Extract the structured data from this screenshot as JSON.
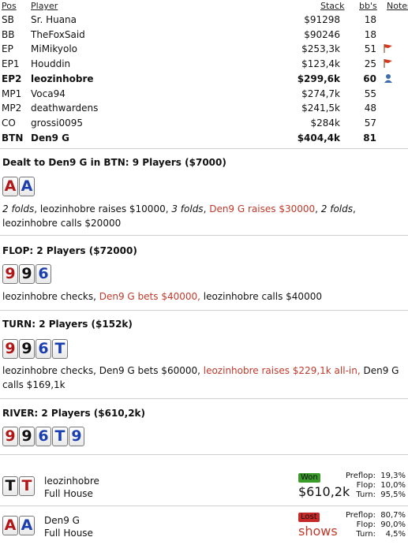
{
  "header": {
    "pos": "Pos",
    "player": "Player",
    "stack": "Stack",
    "bbs": "bb's",
    "notes": "Notes"
  },
  "players": [
    {
      "pos": "SB",
      "name": "Sr. Huana",
      "stack": "$91298",
      "bbs": "18",
      "note": "",
      "bold": false
    },
    {
      "pos": "BB",
      "name": "TheFoxSaid",
      "stack": "$90246",
      "bbs": "18",
      "note": "",
      "bold": false
    },
    {
      "pos": "EP",
      "name": "MiMikyolo",
      "stack": "$253,3k",
      "bbs": "51",
      "note": "flag-icon",
      "bold": false
    },
    {
      "pos": "EP1",
      "name": "Houddin",
      "stack": "$123,4k",
      "bbs": "25",
      "note": "flag-icon",
      "bold": false
    },
    {
      "pos": "EP2",
      "name": "leozinhobre",
      "stack": "$299,6k",
      "bbs": "60",
      "note": "user-icon",
      "bold": true
    },
    {
      "pos": "MP1",
      "name": "Voca94",
      "stack": "$274,7k",
      "bbs": "55",
      "note": "",
      "bold": false
    },
    {
      "pos": "MP2",
      "name": "deathwardens",
      "stack": "$241,5k",
      "bbs": "48",
      "note": "",
      "bold": false
    },
    {
      "pos": "CO",
      "name": "grossi0095",
      "stack": "$284k",
      "bbs": "57",
      "note": "",
      "bold": false
    },
    {
      "pos": "BTN",
      "name": "Den9 G",
      "stack": "$404,4k",
      "bbs": "81",
      "note": "",
      "bold": true
    }
  ],
  "preflop": {
    "title": "Dealt to Den9 G in BTN: 9 Players ($7000)",
    "cards": [
      {
        "rank": "A",
        "suit": "hearts"
      },
      {
        "rank": "A",
        "suit": "diamonds"
      }
    ],
    "actions": [
      {
        "text": "2 folds",
        "style": "it"
      },
      {
        "text": ", leozinhobre raises $10000, ",
        "style": ""
      },
      {
        "text": "3 folds",
        "style": "it"
      },
      {
        "text": ", ",
        "style": ""
      },
      {
        "text": "Den9 G raises $30000",
        "style": "red"
      },
      {
        "text": ", ",
        "style": ""
      },
      {
        "text": "2 folds",
        "style": "it"
      },
      {
        "text": ", leozinhobre calls $20000",
        "style": ""
      }
    ]
  },
  "flop": {
    "title": "FLOP: 2 Players ($72000)",
    "cards": [
      {
        "rank": "9",
        "suit": "hearts"
      },
      {
        "rank": "9",
        "suit": "spades"
      },
      {
        "rank": "6",
        "suit": "diamonds"
      }
    ],
    "actions": [
      {
        "text": "leozinhobre checks, ",
        "style": ""
      },
      {
        "text": "Den9 G bets $40000,",
        "style": "red"
      },
      {
        "text": " leozinhobre calls $40000",
        "style": ""
      }
    ]
  },
  "turn": {
    "title": "TURN: 2 Players ($152k)",
    "cards": [
      {
        "rank": "9",
        "suit": "hearts"
      },
      {
        "rank": "9",
        "suit": "spades"
      },
      {
        "rank": "6",
        "suit": "diamonds"
      },
      {
        "rank": "T",
        "suit": "diamonds"
      }
    ],
    "actions": [
      {
        "text": "leozinhobre checks, Den9 G bets $60000, ",
        "style": ""
      },
      {
        "text": "leozinhobre raises $229,1k all-in,",
        "style": "red"
      },
      {
        "text": " Den9 G calls $169,1k",
        "style": ""
      }
    ]
  },
  "river": {
    "title": "RIVER: 2 Players ($610,2k)",
    "cards": [
      {
        "rank": "9",
        "suit": "hearts"
      },
      {
        "rank": "9",
        "suit": "spades"
      },
      {
        "rank": "6",
        "suit": "diamonds"
      },
      {
        "rank": "T",
        "suit": "diamonds"
      },
      {
        "rank": "9",
        "suit": "diamonds"
      }
    ]
  },
  "results": [
    {
      "cards": [
        {
          "rank": "T",
          "suit": "spades"
        },
        {
          "rank": "T",
          "suit": "hearts"
        }
      ],
      "name": "leozinhobre",
      "hand": "Full House",
      "badge": "Won",
      "badge_color": "#3a9a2a",
      "amount": "$610,2k",
      "amount_color": "#111",
      "stats": [
        {
          "label": "Preflop:",
          "value": "19,3%"
        },
        {
          "label": "Flop:",
          "value": "10,0%"
        },
        {
          "label": "Turn:",
          "value": "95,5%"
        }
      ]
    },
    {
      "cards": [
        {
          "rank": "A",
          "suit": "hearts"
        },
        {
          "rank": "A",
          "suit": "diamonds"
        }
      ],
      "name": "Den9 G",
      "hand": "Full House",
      "badge": "Lost",
      "badge_color": "#c62828",
      "amount": "shows",
      "amount_color": "#c0392b",
      "stats": [
        {
          "label": "Preflop:",
          "value": "80,7%"
        },
        {
          "label": "Flop:",
          "value": "90,0%"
        },
        {
          "label": "Turn:",
          "value": "4,5%"
        }
      ]
    }
  ],
  "suit_colors": {
    "hearts": "#b01818",
    "diamonds": "#1c3fb0",
    "spades": "#111111",
    "clubs": "#1a7a1a"
  }
}
